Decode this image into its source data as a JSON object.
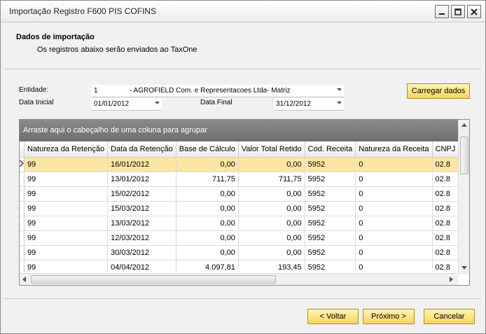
{
  "window": {
    "title": "Importação Registro F600 PIS COFINS"
  },
  "header": {
    "title": "Dados de importação",
    "subtitle": "Os registros abaixo serão enviados ao TaxOne"
  },
  "form": {
    "entidade_label": "Entidade:",
    "entidade_code": "1",
    "entidade_name": "- AGROFIELD Com. e Representacoes Ltda- Matriz",
    "data_inicial_label": "Data Inicial",
    "data_inicial_value": "01/01/2012",
    "data_final_label": "Data Final",
    "data_final_value": "31/12/2012",
    "load_button": "Carregar dados"
  },
  "grid": {
    "group_hint": "Arraste aqui o cabeçalho de uma coluna para agrupar",
    "columns": [
      "Natureza da Retenção",
      "Data da Retenção",
      "Base de Cálculo",
      "Valor Total Retido",
      "Cod. Receita",
      "Natureza da Receita",
      "CNPJ"
    ],
    "rows": [
      [
        "99",
        "16/01/2012",
        "0,00",
        "0,00",
        "5952",
        "0",
        "02.8"
      ],
      [
        "99",
        "13/01/2012",
        "711,75",
        "711,75",
        "5952",
        "0",
        "02.8"
      ],
      [
        "99",
        "15/02/2012",
        "0,00",
        "0,00",
        "5952",
        "0",
        "02.8"
      ],
      [
        "99",
        "15/03/2012",
        "0,00",
        "0,00",
        "5952",
        "0",
        "02.8"
      ],
      [
        "99",
        "13/03/2012",
        "0,00",
        "0,00",
        "5952",
        "0",
        "02.8"
      ],
      [
        "99",
        "12/03/2012",
        "0,00",
        "0,00",
        "5952",
        "0",
        "02.8"
      ],
      [
        "99",
        "30/03/2012",
        "0,00",
        "0,00",
        "5952",
        "0",
        "02.8"
      ],
      [
        "99",
        "04/04/2012",
        "4.097,81",
        "193,45",
        "5952",
        "0",
        "02.8"
      ]
    ],
    "selected_row": 0
  },
  "footer": {
    "back_button": "< Voltar",
    "next_button": "Próximo >",
    "cancel_button": "Cancelar"
  },
  "colors": {
    "button_fill": "#f7d65a",
    "selected_row": "#fbe6a3",
    "group_panel": "#7d7d7d"
  }
}
